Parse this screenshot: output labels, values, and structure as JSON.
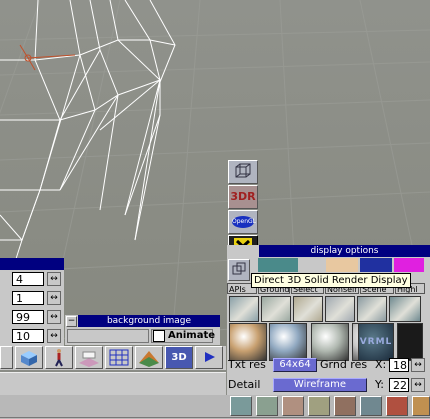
{
  "left_panel": {
    "values": [
      "4",
      "1",
      "99",
      "10"
    ],
    "spin_glyph": "↔"
  },
  "background_panel": {
    "title": "background image",
    "minimize_glyph": "−",
    "animate_label": "Animate",
    "animate_checked": false
  },
  "vertical_toolbar": {
    "icons": [
      "wireframe-cube-icon",
      "3dr-logo-icon",
      "opengl-logo-icon",
      "direct3d-icon"
    ],
    "labels": {
      "3dr": "3DR",
      "opengl": "OpenGL"
    }
  },
  "display_options": {
    "title": "display options",
    "tooltip": "Direct 3D Solid Render Display",
    "tabs": [
      "APIs",
      "Ground",
      "Select",
      "Nonself",
      "Scene",
      "Highl"
    ],
    "swatch_colors": [
      "#4a8a8a",
      "#e8c8a0",
      "#2030a0",
      "#e020e0"
    ],
    "thumb_colors": [
      "#8aa0a8",
      "#9aa8a0",
      "#b0a890",
      "#a0a8b0",
      "#8a9aa0",
      "#708a90"
    ],
    "sphere_colors": [
      "#c8a070",
      "#90a8c0",
      "#b0b8b0",
      "#c8c8c8",
      "#406070"
    ],
    "vrml_label": "VRML",
    "txt_res_label": "Txt res",
    "txt_res_value": "64x64",
    "grnd_res_label": "Grnd res",
    "x_label": "X:",
    "x_value": "18",
    "detail_label": "Detail",
    "detail_value": "Wireframe",
    "y_label": "Y:",
    "y_value": "22"
  },
  "bottom_toolbar": {
    "icons": [
      "cube-icon",
      "walking-man-icon",
      "ground-plane-icon",
      "grid-icon",
      "landscape-icon",
      "3d-view-icon",
      "play-icon"
    ],
    "label_3d": "3D"
  },
  "bottom_strip": {
    "icons": [
      "strip-icon-1",
      "strip-icon-2",
      "strip-icon-3",
      "strip-icon-4",
      "strip-icon-5",
      "strip-icon-6",
      "strip-icon-7",
      "strip-icon-8"
    ]
  }
}
